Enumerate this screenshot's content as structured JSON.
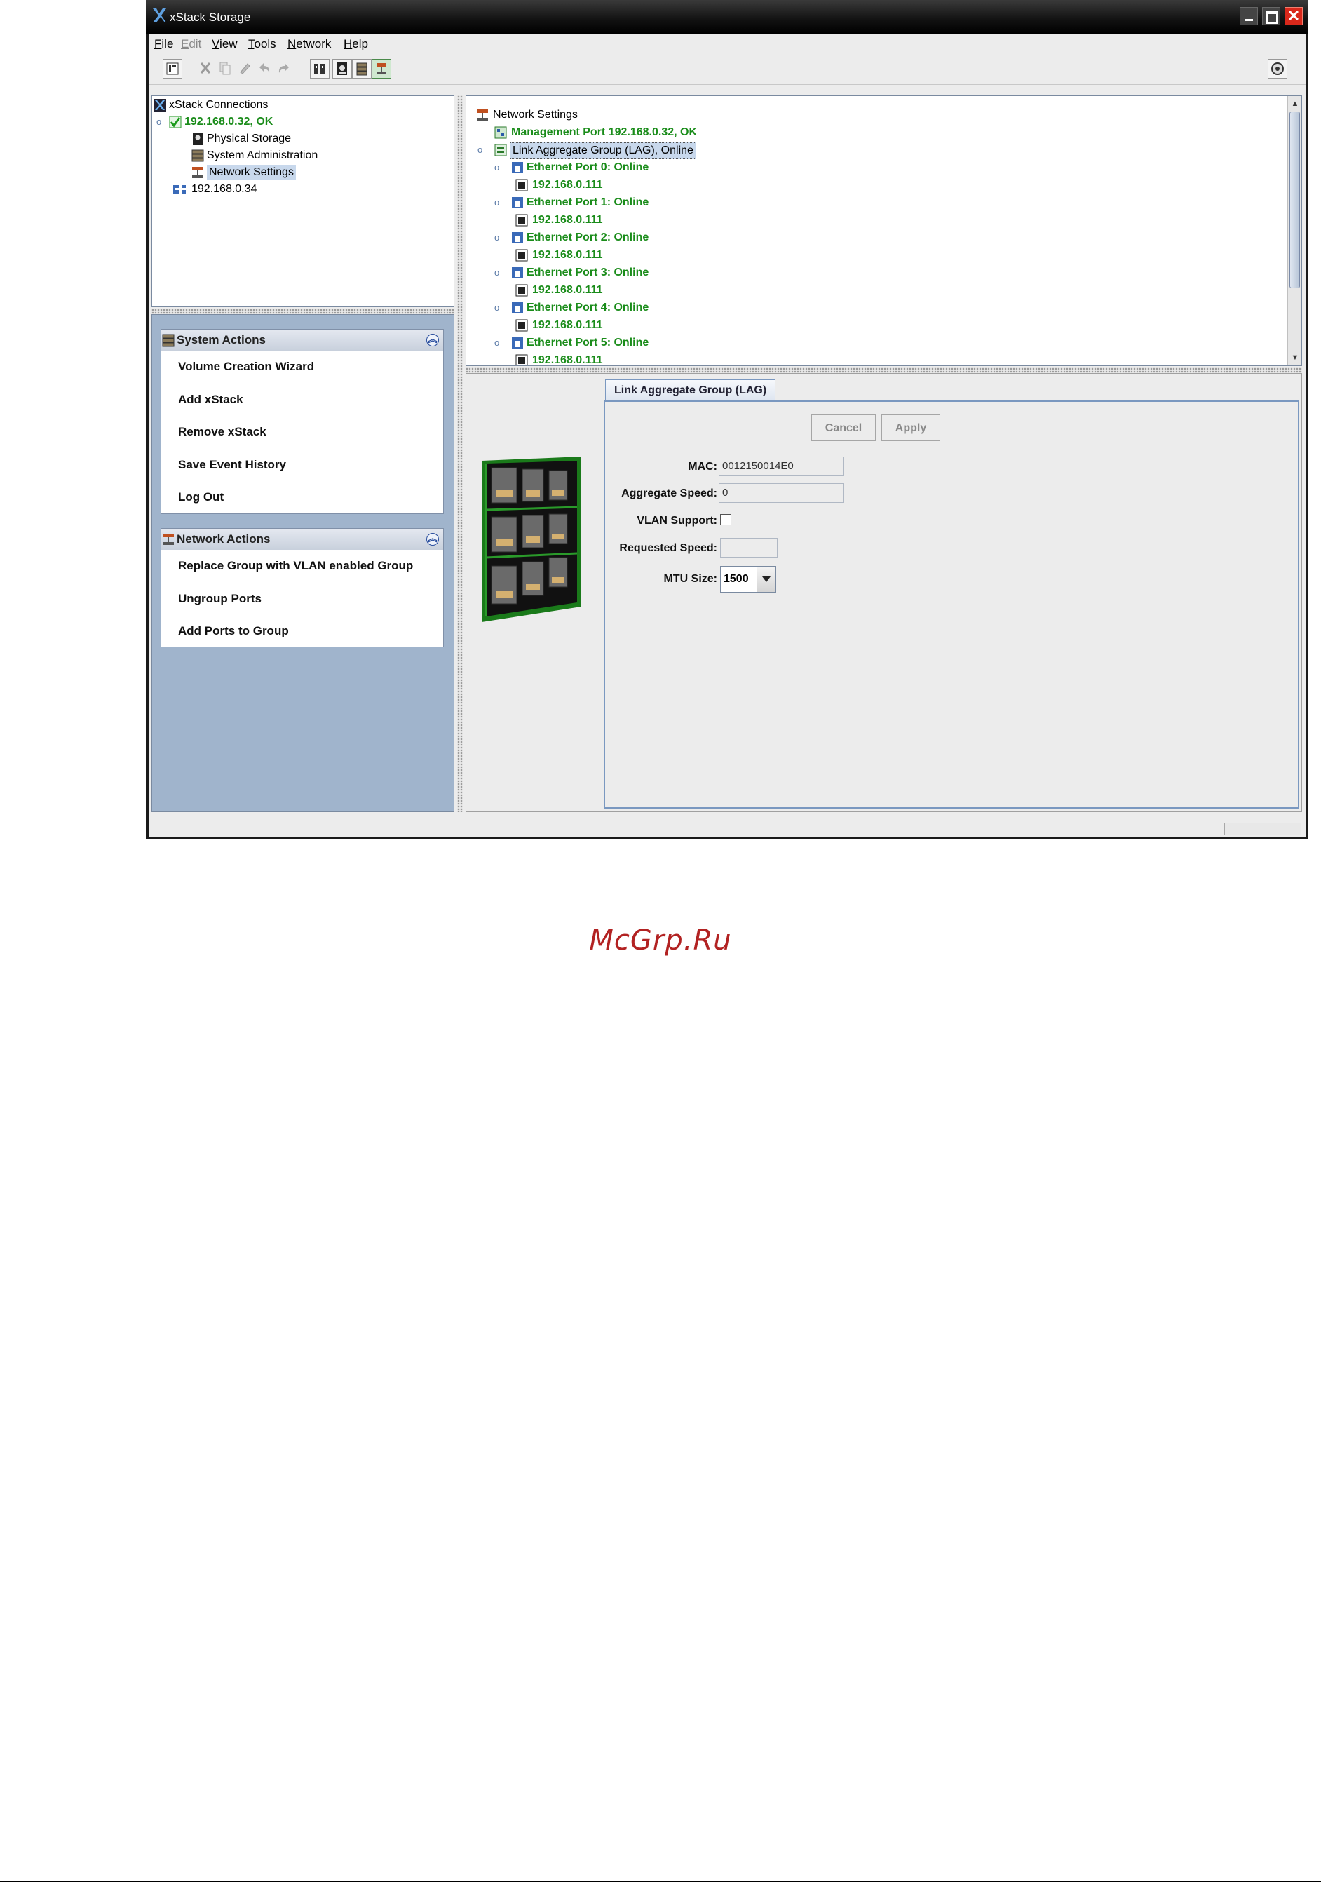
{
  "window": {
    "title": "xStack Storage"
  },
  "menu": [
    {
      "label_rest": "ile",
      "mnemonic": "F",
      "enabled": true
    },
    {
      "label_rest": "dit",
      "mnemonic": "E",
      "enabled": false
    },
    {
      "label_rest": "iew",
      "mnemonic": "V",
      "enabled": true
    },
    {
      "label_rest": "ools",
      "mnemonic": "T",
      "enabled": true
    },
    {
      "label_rest": "etwork",
      "mnemonic": "N",
      "enabled": true
    },
    {
      "label_rest": "elp",
      "mnemonic": "H",
      "enabled": true
    }
  ],
  "toolbar": {
    "icons": [
      "properties-icon",
      "cut-icon",
      "copy-icon",
      "paste-icon",
      "undo-icon",
      "redo-icon",
      "hardware-icon",
      "physical-storage-icon",
      "system-admin-icon",
      "network-settings-icon",
      "help-icon"
    ]
  },
  "connections_tree": {
    "root": "xStack Connections",
    "node1": "192.168.0.32, OK",
    "children": [
      "Physical Storage",
      "System Administration",
      "Network Settings"
    ],
    "node2": "192.168.0.34"
  },
  "system_actions": {
    "title": "System Actions",
    "items": [
      "Volume Creation Wizard",
      "Add xStack",
      "Remove xStack",
      "Save Event History",
      "Log Out"
    ]
  },
  "network_actions": {
    "title": "Network Actions",
    "items": [
      "Replace Group with VLAN enabled Group",
      "Ungroup Ports",
      "Add Ports to Group"
    ]
  },
  "network_tree": {
    "root": "Network Settings",
    "management": "Management Port 192.168.0.32, OK",
    "lag": "Link Aggregate Group (LAG), Online",
    "ports": [
      {
        "label": "Ethernet Port 0: Online",
        "ip": "192.168.0.111"
      },
      {
        "label": "Ethernet Port 1: Online",
        "ip": "192.168.0.111"
      },
      {
        "label": "Ethernet Port 2: Online",
        "ip": "192.168.0.111"
      },
      {
        "label": "Ethernet Port 3: Online",
        "ip": "192.168.0.111"
      },
      {
        "label": "Ethernet Port 4: Online",
        "ip": "192.168.0.111"
      },
      {
        "label": "Ethernet Port 5: Online",
        "ip": "192.168.0.111"
      }
    ]
  },
  "detail": {
    "tab": "Link Aggregate Group (LAG)",
    "cancel": "Cancel",
    "apply": "Apply",
    "mac_label": "MAC:",
    "mac_value": "0012150014E0",
    "agg_speed_label": "Aggregate Speed:",
    "agg_speed_value": "0",
    "vlan_label": "VLAN Support:",
    "vlan_checked": false,
    "req_speed_label": "Requested Speed:",
    "req_speed_value": "",
    "mtu_label": "MTU Size:",
    "mtu_value": "1500"
  },
  "watermark": "McGrp.Ru",
  "colors": {
    "online_green": "#1a8c1a",
    "selection": "#c8d8ec",
    "panel_blue": "#a0b4cc",
    "close_red": "#d9281b"
  }
}
